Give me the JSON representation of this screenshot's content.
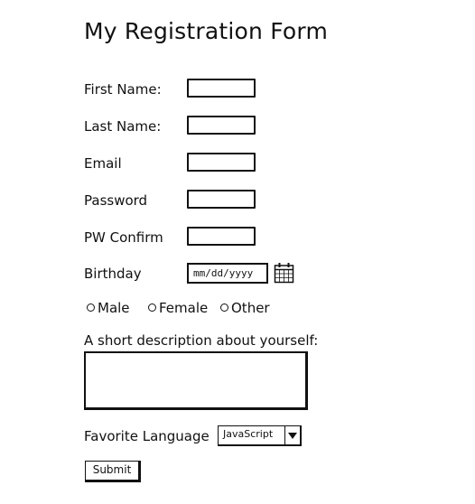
{
  "form": {
    "title": "My Registration Form",
    "fields": [
      {
        "label": "First Name:",
        "value": ""
      },
      {
        "label": "Last Name:",
        "value": ""
      },
      {
        "label": "Email",
        "value": ""
      },
      {
        "label": "Password",
        "value": ""
      },
      {
        "label": "PW Confirm",
        "value": ""
      }
    ],
    "birthday": {
      "label": "Birthday",
      "placeholder": "mm/dd/yyyy",
      "icon": "calendar-icon"
    },
    "gender_options": [
      "Male",
      "Female",
      "Other"
    ],
    "description": {
      "label": "A short description about yourself:",
      "value": ""
    },
    "language": {
      "label": "Favorite Language",
      "selected": "JavaScript",
      "icon": "chevron-down-icon"
    },
    "submit_label": "Submit"
  }
}
